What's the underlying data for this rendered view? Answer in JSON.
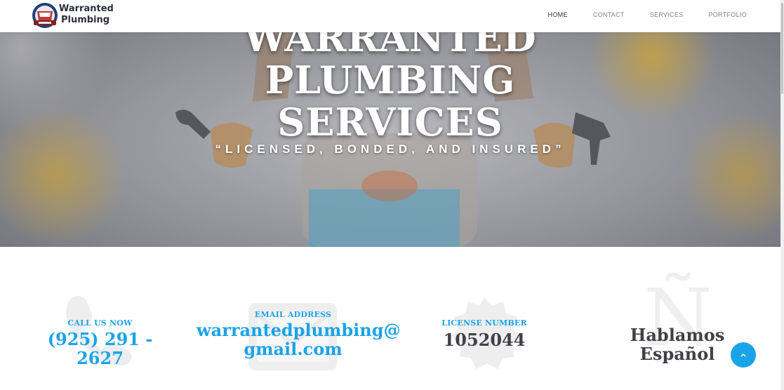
{
  "brand": {
    "name_line1": "Warranted",
    "name_line2": "Plumbing"
  },
  "nav": {
    "items": [
      {
        "label": "HOME",
        "active": true
      },
      {
        "label": "CONTACT",
        "active": false
      },
      {
        "label": "SERVICES",
        "active": false
      },
      {
        "label": "PORTFOLIO",
        "active": false
      }
    ]
  },
  "hero": {
    "title_line1": "WARRANTED",
    "title_line2": "PLUMBING",
    "title_line3": "SERVICES",
    "subtitle": "“LICENSED, BONDED, AND INSURED”"
  },
  "info": {
    "call": {
      "label": "CALL US NOW",
      "value": "(925) 291 - 2627",
      "icon": "phone-icon"
    },
    "email": {
      "label": "EMAIL ADDRESS",
      "value_line1": "warrantedplumbing@",
      "value_line2": "gmail.com",
      "icon": "envelope-icon"
    },
    "license": {
      "label": "LICENSE NUMBER",
      "value": "1052044",
      "icon": "badge-icon"
    },
    "spanish": {
      "value": "Hablamos Español",
      "icon_glyph": "Ñ"
    }
  },
  "colors": {
    "accent": "#1aa3e8",
    "dark_text": "#3f4148"
  },
  "scroll_top": {
    "icon": "chevron-up-icon"
  }
}
